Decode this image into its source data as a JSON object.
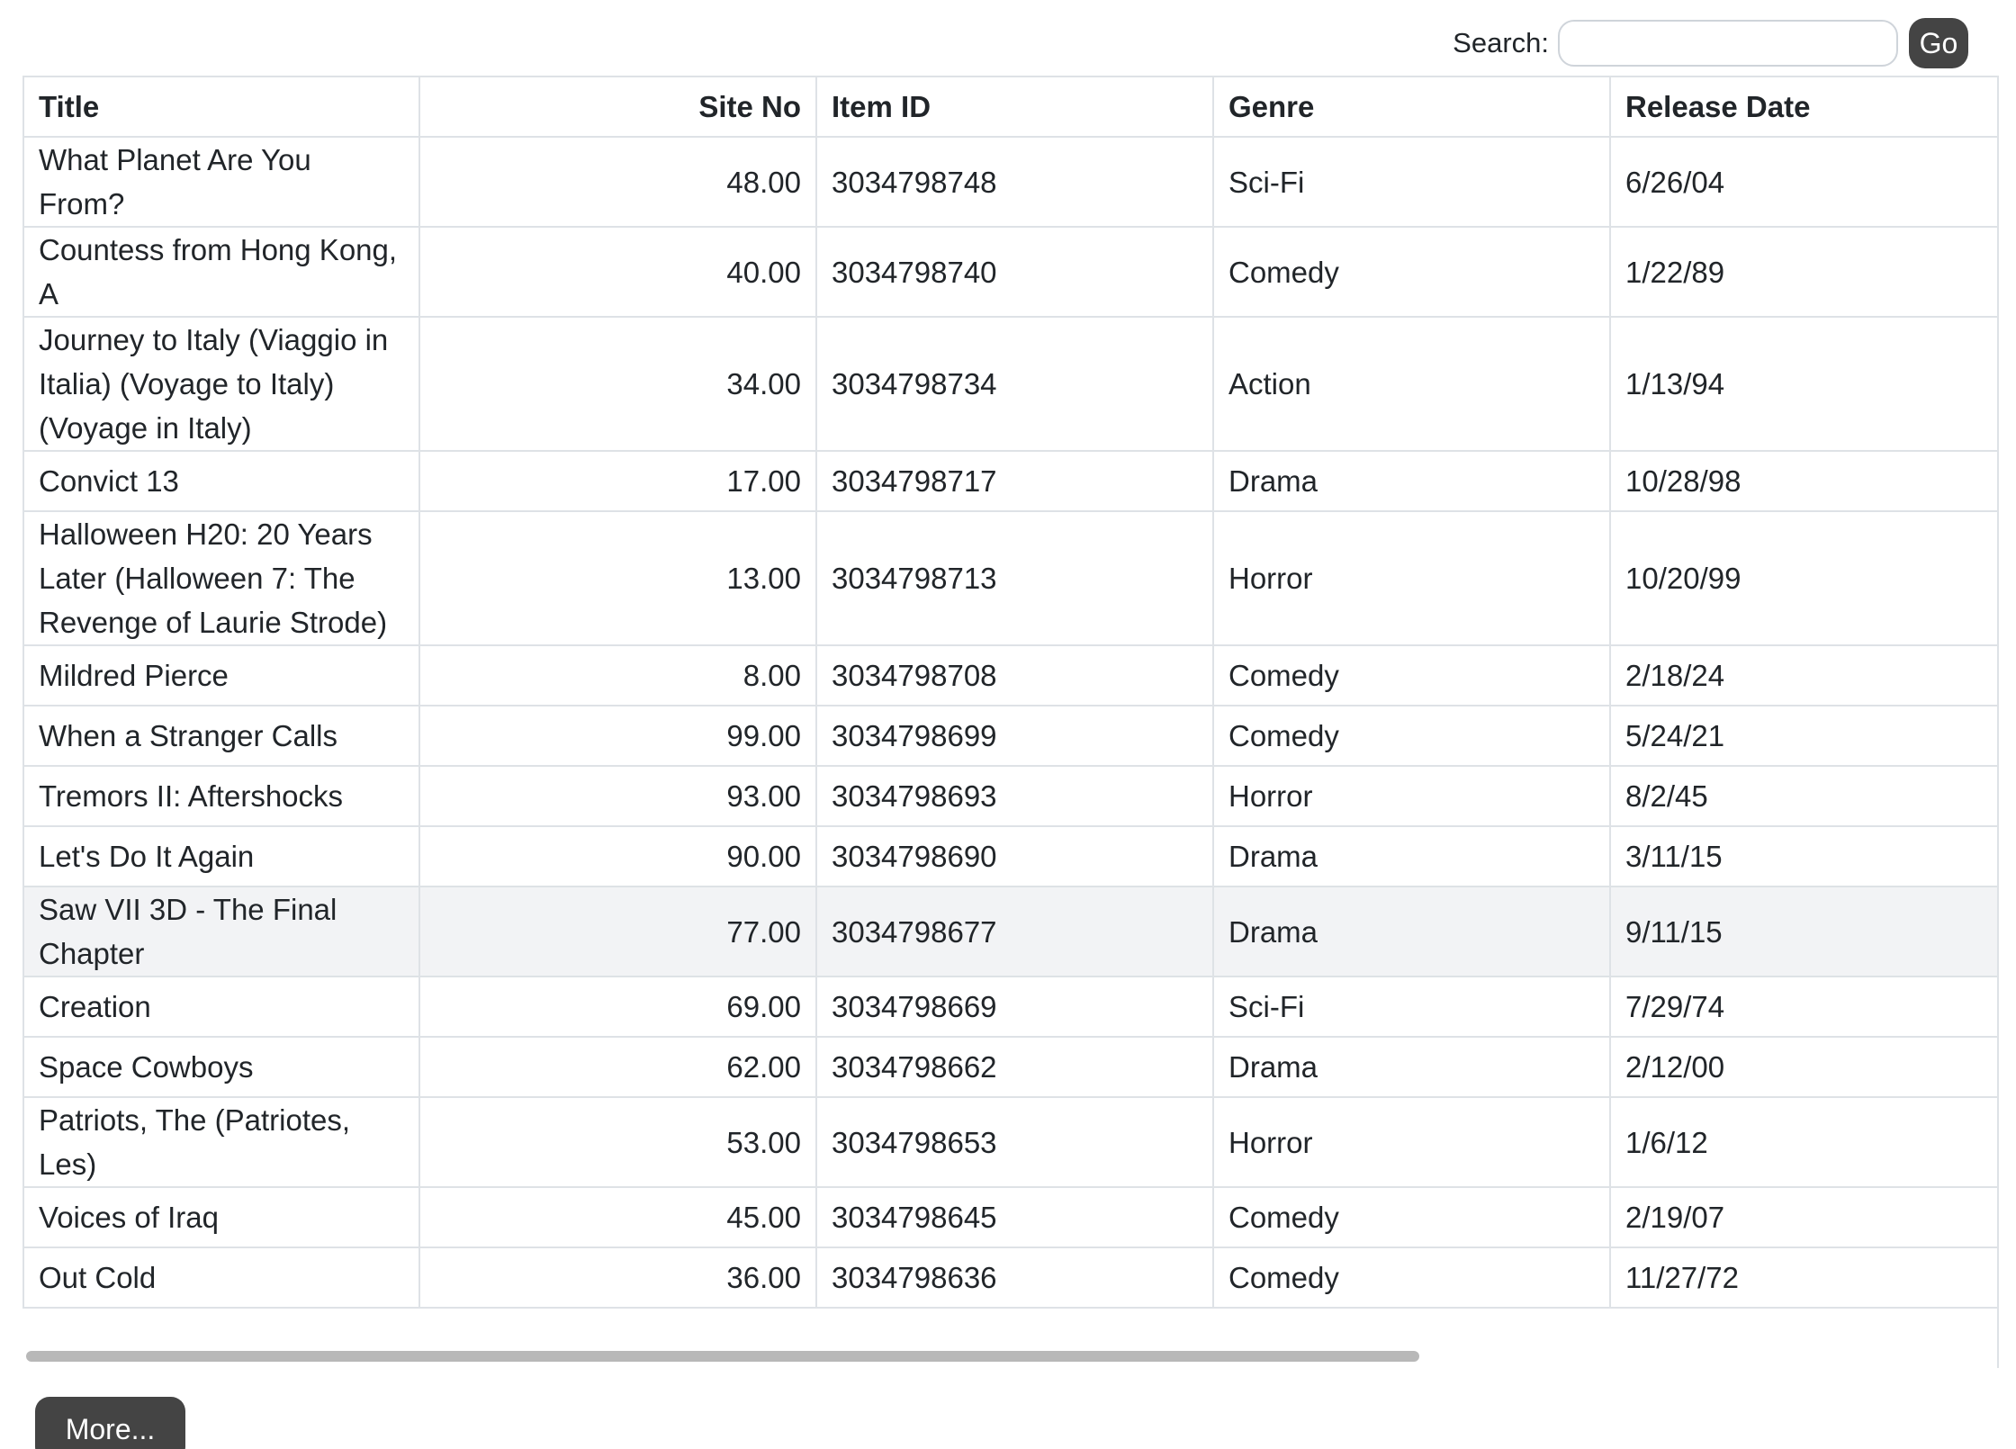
{
  "search": {
    "label": "Search:",
    "value": "",
    "placeholder": "",
    "go_label": "Go"
  },
  "table": {
    "columns": [
      "Title",
      "Site No",
      "Item ID",
      "Genre",
      "Release Date"
    ],
    "rows": [
      {
        "title": "What Planet Are You From?",
        "site_no": "48.00",
        "item_id": "3034798748",
        "genre": "Sci-Fi",
        "release_date": "6/26/04"
      },
      {
        "title": "Countess from Hong Kong, A",
        "site_no": "40.00",
        "item_id": "3034798740",
        "genre": "Comedy",
        "release_date": "1/22/89"
      },
      {
        "title": "Journey to Italy (Viaggio in Italia) (Voyage to Italy) (Voyage in Italy)",
        "site_no": "34.00",
        "item_id": "3034798734",
        "genre": "Action",
        "release_date": "1/13/94"
      },
      {
        "title": "Convict 13",
        "site_no": "17.00",
        "item_id": "3034798717",
        "genre": "Drama",
        "release_date": "10/28/98"
      },
      {
        "title": "Halloween H20: 20 Years Later (Halloween 7: The Revenge of Laurie Strode)",
        "site_no": "13.00",
        "item_id": "3034798713",
        "genre": "Horror",
        "release_date": "10/20/99"
      },
      {
        "title": "Mildred Pierce",
        "site_no": "8.00",
        "item_id": "3034798708",
        "genre": "Comedy",
        "release_date": "2/18/24"
      },
      {
        "title": "When a Stranger Calls",
        "site_no": "99.00",
        "item_id": "3034798699",
        "genre": "Comedy",
        "release_date": "5/24/21"
      },
      {
        "title": "Tremors II: Aftershocks",
        "site_no": "93.00",
        "item_id": "3034798693",
        "genre": "Horror",
        "release_date": "8/2/45"
      },
      {
        "title": "Let's Do It Again",
        "site_no": "90.00",
        "item_id": "3034798690",
        "genre": "Drama",
        "release_date": "3/11/15"
      },
      {
        "title": "Saw VII 3D - The Final Chapter",
        "site_no": "77.00",
        "item_id": "3034798677",
        "genre": "Drama",
        "release_date": "9/11/15"
      },
      {
        "title": "Creation",
        "site_no": "69.00",
        "item_id": "3034798669",
        "genre": "Sci-Fi",
        "release_date": "7/29/74"
      },
      {
        "title": "Space Cowboys",
        "site_no": "62.00",
        "item_id": "3034798662",
        "genre": "Drama",
        "release_date": "2/12/00"
      },
      {
        "title": "Patriots, The (Patriotes, Les)",
        "site_no": "53.00",
        "item_id": "3034798653",
        "genre": "Horror",
        "release_date": "1/6/12"
      },
      {
        "title": "Voices of Iraq",
        "site_no": "45.00",
        "item_id": "3034798645",
        "genre": "Comedy",
        "release_date": "2/19/07"
      },
      {
        "title": "Out Cold",
        "site_no": "36.00",
        "item_id": "3034798636",
        "genre": "Comedy",
        "release_date": "11/27/72"
      }
    ]
  },
  "more_label": "More...",
  "colors": {
    "button_bg": "#444444",
    "button_text": "#ffffff",
    "border": "#dee2e6",
    "hover_row_bg": "#f2f3f5",
    "scrollbar": "#b8b8b8"
  }
}
